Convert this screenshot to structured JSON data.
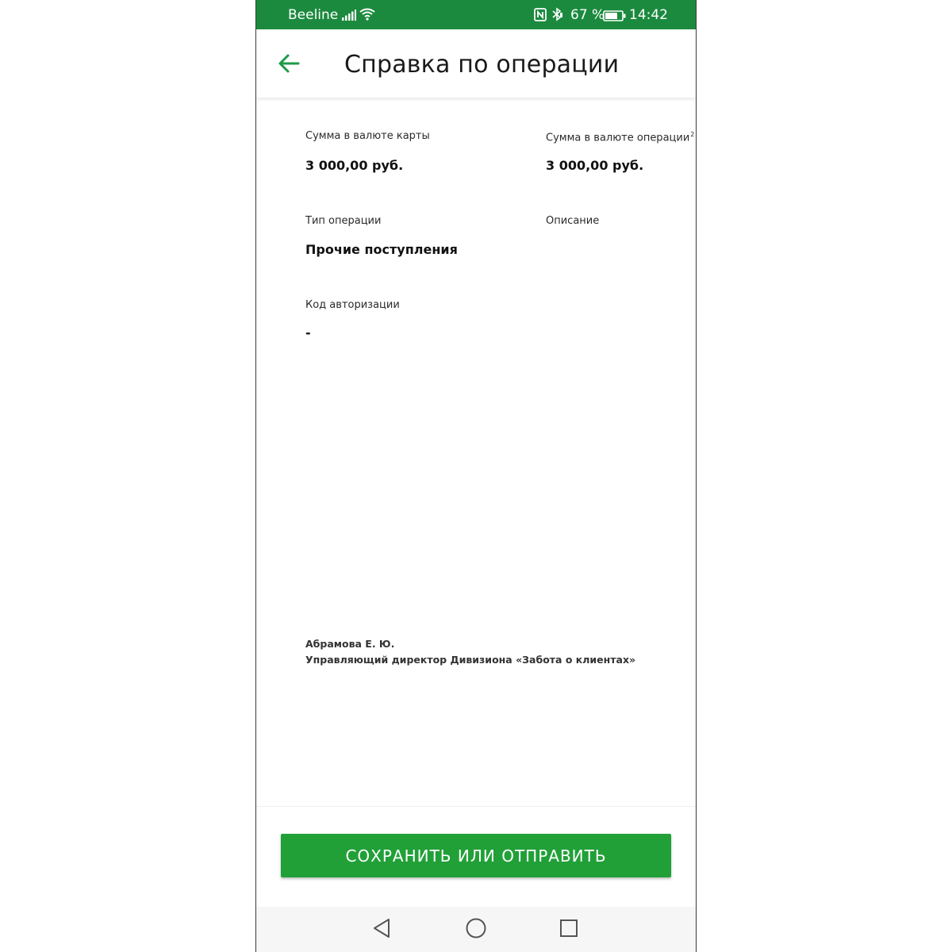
{
  "status_bar": {
    "carrier": "Beeline",
    "battery_pct": "67 %",
    "time": "14:42",
    "icons": [
      "signal-icon",
      "wifi-icon",
      "nfc-icon",
      "bluetooth-icon",
      "battery-icon"
    ]
  },
  "header": {
    "title": "Справка по операции",
    "back_icon": "arrow-left-icon"
  },
  "details": {
    "card_currency_label": "Сумма в валюте карты",
    "card_currency_value": "3 000,00 руб.",
    "operation_currency_label": "Сумма в валюте операции",
    "operation_currency_footnote": "2",
    "operation_currency_value": "3 000,00 руб.",
    "operation_type_label": "Тип операции",
    "operation_type_value": "Прочие поступления",
    "description_label": "Описание",
    "auth_code_label": "Код авторизации",
    "auth_code_value": "-"
  },
  "signature": {
    "name": "Абрамова Е. Ю.",
    "role": "Управляющий директор Дивизиона «Забота о клиентах»"
  },
  "actions": {
    "save_label": "СОХРАНИТЬ ИЛИ ОТПРАВИТЬ"
  },
  "nav_bar": {
    "icons": [
      "nav-back-icon",
      "nav-home-icon",
      "nav-recent-icon"
    ]
  },
  "colors": {
    "status_bar": "#1b8a3e",
    "accent": "#21a038",
    "icon_green": "#1e9a48"
  }
}
